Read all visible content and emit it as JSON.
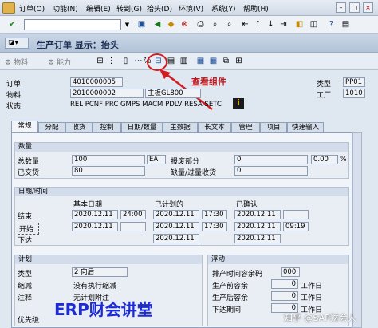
{
  "menu": [
    "订单(O)",
    "功能(N)",
    "编辑(E)",
    "转到(G)",
    "抬头(D)",
    "环境(V)",
    "系统(Y)",
    "帮助(H)"
  ],
  "title": "生产订单 显示：抬头",
  "toolbar2": {
    "material_label": "物料",
    "capacity_label": "能力"
  },
  "annotation": "查看组件",
  "header": {
    "order_label": "订单",
    "order_value": "4010000005",
    "material_label": "物料",
    "material_value": "2010000002",
    "material_desc": "主板GL800",
    "status_label": "状态",
    "status_value": "REL  PCNF PRC  GMPS MACM PDLV RESA SETC",
    "type_label": "类型",
    "type_value": "PP01",
    "plant_label": "工厂",
    "plant_value": "1010"
  },
  "tabs": [
    "常规",
    "分配",
    "收货",
    "控制",
    "日期/数量",
    "主数据",
    "长文本",
    "管理",
    "项目",
    "快速输入"
  ],
  "quantity": {
    "title": "数量",
    "total_label": "总数量",
    "total_value": "100",
    "unit": "EA",
    "scrap_label": "报废部分",
    "scrap_value": "0",
    "scrap_pct": "0.00",
    "pct_sign": "%",
    "delivered_label": "已交货",
    "delivered_value": "80",
    "short_label": "缺量/过量收货",
    "short_value": "0"
  },
  "dates": {
    "title": "日期/时间",
    "col_basic": "基本日期",
    "col_scheduled": "已计划的",
    "col_confirmed": "已确认",
    "rows": [
      {
        "label": "结束",
        "basic_date": "2020.12.11",
        "basic_time": "24:00",
        "sched_date": "2020.12.11",
        "sched_time": "17:30",
        "conf_date": "2020.12.11",
        "conf_time": ""
      },
      {
        "label": "开始",
        "basic_date": "2020.12.11",
        "basic_time": "",
        "sched_date": "2020.12.11",
        "sched_time": "17:30",
        "conf_date": "2020.12.11",
        "conf_time": "09:19"
      },
      {
        "label": "下达",
        "basic_date": "",
        "basic_time": "",
        "sched_date": "2020.12.11",
        "sched_time": "",
        "conf_date": "2020.12.11",
        "conf_time": ""
      }
    ]
  },
  "plan": {
    "title": "计划",
    "type_label": "类型",
    "type_value": "2 向后",
    "reduce_label": "缩减",
    "reduce_value": "没有执行缩减",
    "note_label": "注释",
    "note_value": "无计划附注",
    "priority_label": "优先级"
  },
  "float": {
    "title": "浮动",
    "sched_margin_label": "排产时间容余码",
    "sched_margin_value": "000",
    "pre_label": "生产前容余",
    "pre_value": "0",
    "pre_unit": "工作日",
    "post_label": "生产后容余",
    "post_value": "0",
    "post_unit": "工作日",
    "release_label": "下达期间",
    "release_value": "0",
    "release_unit": "工作日"
  },
  "watermark_main": "ERP财会讲堂",
  "watermark_sub": "知乎 @SAP财会人"
}
